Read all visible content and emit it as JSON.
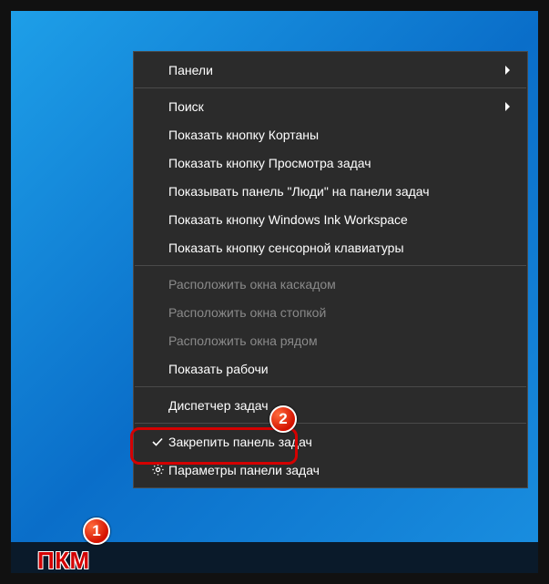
{
  "menu": {
    "panels": "Панели",
    "search": "Поиск",
    "show_cortana": "Показать кнопку Кортаны",
    "show_taskview": "Показать кнопку Просмотра задач",
    "show_people": "Показывать панель \"Люди\" на панели задач",
    "show_ink": "Показать кнопку Windows Ink Workspace",
    "show_touchkb": "Показать кнопку сенсорной клавиатуры",
    "cascade": "Расположить окна каскадом",
    "stacked": "Расположить окна стопкой",
    "sidebyside": "Расположить окна рядом",
    "show_desktop": "Показать рабочи",
    "task_manager": "Диспетчер задач",
    "lock_taskbar": "Закрепить панель задач",
    "taskbar_settings": "Параметры панели задач"
  },
  "annotations": {
    "badge1": "1",
    "badge2": "2",
    "pkm": "ПКМ"
  }
}
